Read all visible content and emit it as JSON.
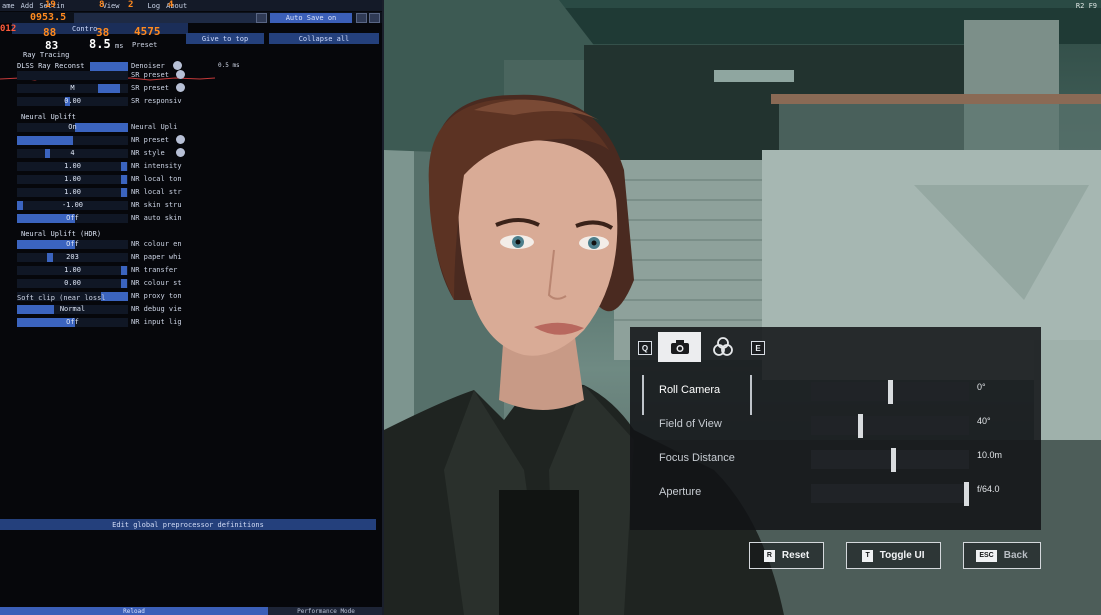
{
  "menu": [
    "ame",
    "Add",
    "Settin",
    "View",
    "Log",
    "About"
  ],
  "perf": {
    "top_orange_1": "19",
    "top_orange_2": "8",
    "top_orange_3": "2",
    "top_orange_4": "4",
    "row_orange": "0953.5",
    "n_012": "012",
    "n_88": "88",
    "n_38": "38",
    "n_4575": "4575",
    "n_83": "83",
    "n_85": "8.5",
    "unit_ms": "ms",
    "preset_label": "Preset",
    "small_ms": "0.5 ms"
  },
  "top_buttons": {
    "auto_save": "Auto Save on",
    "contro": "Contro",
    "give_to_top": "Give to top",
    "collapse_all": "Collapse all"
  },
  "sections": {
    "ray_tracing": "Ray Tracing",
    "dlss": "DLSS Ray Reconst",
    "neural_uplift": "Neural Uplift",
    "neural_uplift_hdr": "Neural Uplift (HDR)"
  },
  "rows": [
    {
      "value": "",
      "label": "SR preset",
      "fill": [
        0.0,
        0.0
      ],
      "help": true
    },
    {
      "value": "M",
      "label": "SR preset",
      "fill": [
        0.73,
        0.93
      ],
      "help": true
    },
    {
      "value": "0.00",
      "label": "SR responsiv",
      "fill": [
        0.43,
        0.48
      ],
      "help": false
    },
    {
      "value": "On",
      "label": "Neural Upli",
      "fill": [
        0.52,
        1.0
      ],
      "help": false
    },
    {
      "value": "",
      "label": "NR preset",
      "fill": [
        0.0,
        0.5
      ],
      "help": true
    },
    {
      "value": "4",
      "label": "NR style",
      "fill": [
        0.25,
        0.3
      ],
      "help": true
    },
    {
      "value": "1.00",
      "label": "NR intensity",
      "fill": [
        0.94,
        0.99
      ],
      "help": false
    },
    {
      "value": "1.00",
      "label": "NR local ton",
      "fill": [
        0.94,
        0.99
      ],
      "help": false
    },
    {
      "value": "1.00",
      "label": "NR local str",
      "fill": [
        0.94,
        0.99
      ],
      "help": false
    },
    {
      "value": "-1.00",
      "label": "NR skin stru",
      "fill": [
        0.0,
        0.05
      ],
      "help": false
    },
    {
      "value": "Off",
      "label": "NR auto skin",
      "fill": [
        0.0,
        0.52
      ],
      "help": false
    },
    {
      "value": "Off",
      "label": "NR colour en",
      "fill": [
        0.0,
        0.52
      ],
      "help": false
    },
    {
      "value": "203",
      "label": "NR paper whi",
      "fill": [
        0.27,
        0.32
      ],
      "help": false
    },
    {
      "value": "1.00",
      "label": "NR transfer",
      "fill": [
        0.94,
        0.99
      ],
      "help": false
    },
    {
      "value": "0.00",
      "label": "NR colour st",
      "fill": [
        0.94,
        0.99
      ],
      "help": false
    },
    {
      "value": "",
      "label": "NR proxy ton",
      "fill": [
        0.76,
        1.0
      ],
      "help": false
    },
    {
      "value": "Normal",
      "label": "NR debug vie",
      "fill": [
        0.0,
        0.33
      ],
      "help": false
    },
    {
      "value": "Off",
      "label": "NR input lig",
      "fill": [
        0.0,
        0.52
      ],
      "help": false
    }
  ],
  "row_extra": {
    "denoiser": "Denoiser",
    "soft_clip": "Soft clip (near lossl"
  },
  "edit_bar": "Edit global preprocessor definitions",
  "bottom_bar": {
    "left": "Reload",
    "right": "Performance Mode"
  },
  "hud_top_right": "R2 F9",
  "photo_mode": {
    "tab_left_key": "Q",
    "tab_right_key": "E",
    "rows": [
      {
        "name": "Roll Camera",
        "value": "0°",
        "pos": 0.5,
        "selected": true
      },
      {
        "name": "Field of View",
        "value": "40°",
        "pos": 0.31,
        "selected": false
      },
      {
        "name": "Focus Distance",
        "value": "10.0m",
        "pos": 0.52,
        "selected": false
      },
      {
        "name": "Aperture",
        "value": "f/64.0",
        "pos": 1.0,
        "selected": false
      }
    ],
    "buttons": [
      {
        "key": "R",
        "label": "Reset"
      },
      {
        "key": "T",
        "label": "Toggle UI"
      },
      {
        "key": "ESC",
        "label": "Back"
      }
    ]
  }
}
